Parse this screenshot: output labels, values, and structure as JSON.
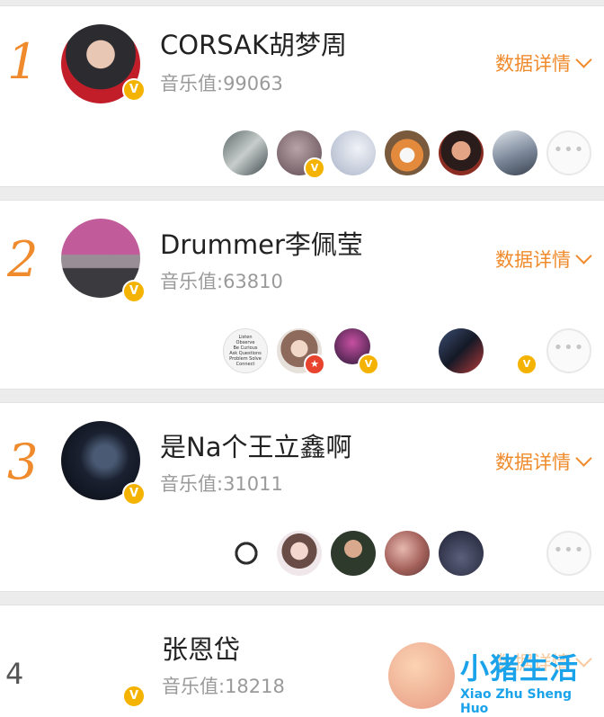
{
  "entries": [
    {
      "rank": "1",
      "name": "CORSAK胡梦周",
      "score": "音乐值:99063",
      "details_label": "数据详情"
    },
    {
      "rank": "2",
      "name": "Drummer李佩莹",
      "score": "音乐值:63810",
      "details_label": "数据详情"
    },
    {
      "rank": "3",
      "name": "是Na个王立鑫啊",
      "score": "音乐值:31011",
      "details_label": "数据详情"
    },
    {
      "rank": "4",
      "name": "张恩岱",
      "score": "音乐值:18218",
      "details_label": "数据详情"
    }
  ],
  "more_label": "•••",
  "verified_glyph": "V",
  "fan_avatar_text": [
    "Listen",
    "Observe",
    "Be Curious",
    "Ask Questions",
    "Problem Solve",
    "Connect"
  ],
  "watermark": {
    "title": "小猪生活",
    "subtitle": "Xiao Zhu Sheng Huo"
  },
  "colors": {
    "accent": "#f08b2d",
    "verified": "#f5b301",
    "separator": "#ececec",
    "watermark": "#1aa3ea"
  }
}
